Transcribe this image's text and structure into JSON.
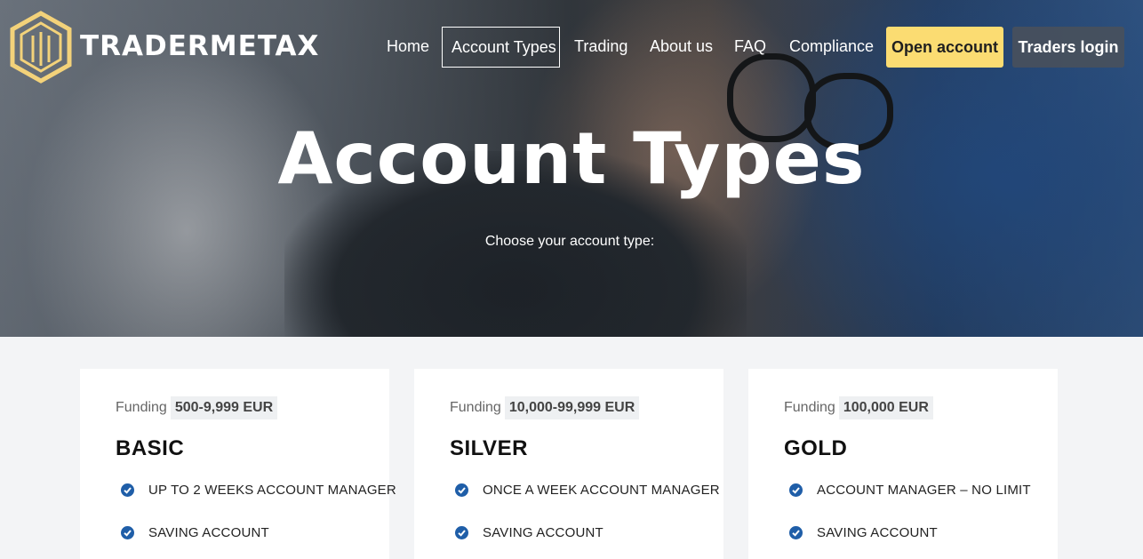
{
  "brand": {
    "name": "TRADERMETAX"
  },
  "nav": {
    "items": [
      {
        "label": "Home"
      },
      {
        "label": "Account Types"
      },
      {
        "label": "Trading"
      },
      {
        "label": "About us"
      },
      {
        "label": "FAQ"
      },
      {
        "label": "Compliance"
      }
    ],
    "active": "Account Types",
    "open_account": "Open account",
    "traders_login": "Traders login"
  },
  "hero": {
    "title": "Account Types",
    "subtitle": "Choose your account type:"
  },
  "cards": [
    {
      "funding_label": "Funding",
      "funding_amount": "500-9,999 EUR",
      "title": "BASIC",
      "features": [
        "UP TO 2 WEEKS ACCOUNT MANAGER",
        "SAVING ACCOUNT"
      ]
    },
    {
      "funding_label": "Funding",
      "funding_amount": "10,000-99,999 EUR",
      "title": "SILVER",
      "features": [
        "ONCE A WEEK ACCOUNT MANAGER",
        "SAVING ACCOUNT"
      ]
    },
    {
      "funding_label": "Funding",
      "funding_amount": "100,000 EUR",
      "title": "GOLD",
      "features": [
        "ACCOUNT MANAGER – NO LIMIT",
        "SAVING ACCOUNT"
      ]
    }
  ],
  "colors": {
    "accent_yellow": "#fbdc72",
    "login_bg": "#48505c",
    "check_blue": "#1f5ea8",
    "logo_gold": "#f3d27a"
  },
  "icons": {
    "logo": "hexagon-logo-icon",
    "check": "check-circle-icon"
  }
}
